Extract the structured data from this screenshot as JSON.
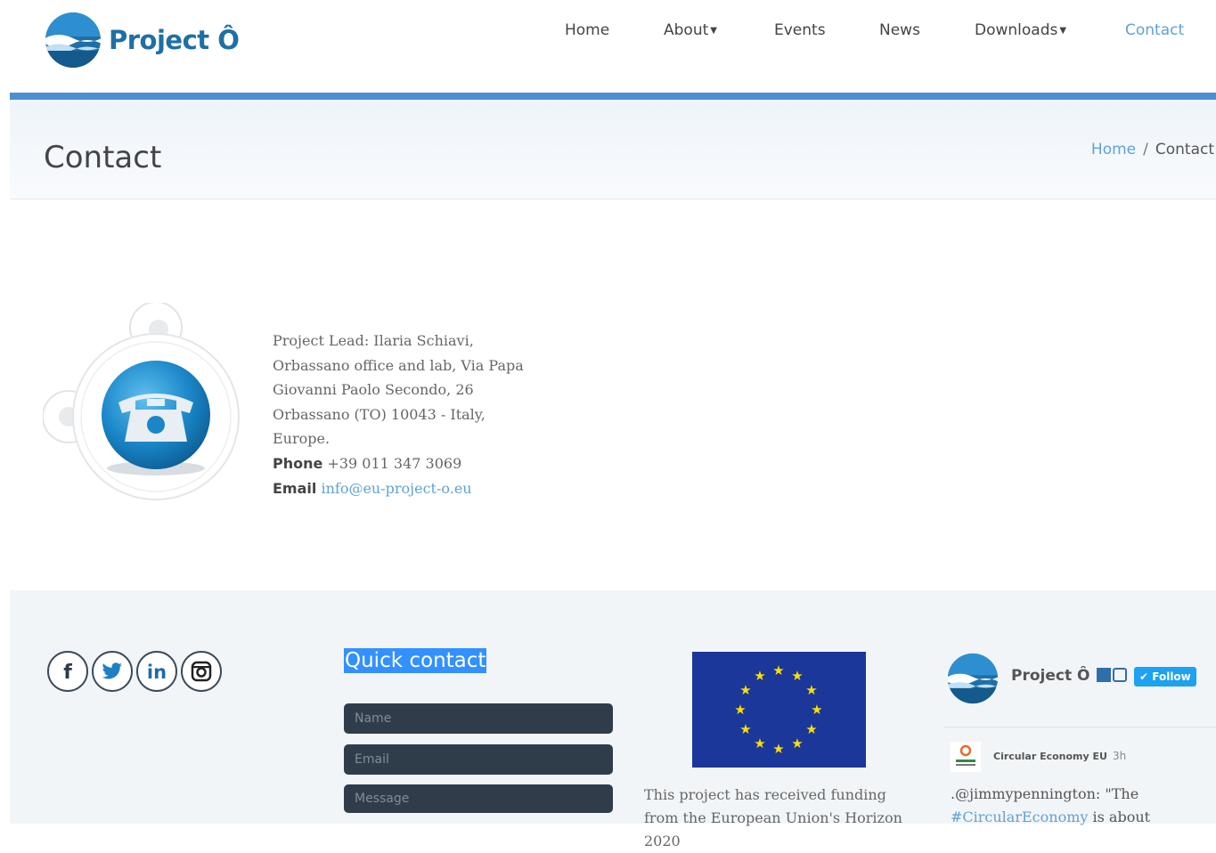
{
  "header": {
    "logo_text": "Project Ô",
    "nav": [
      {
        "label": "Home",
        "dropdown": false,
        "active": false
      },
      {
        "label": "About",
        "dropdown": true,
        "active": false
      },
      {
        "label": "Events",
        "dropdown": false,
        "active": false
      },
      {
        "label": "News",
        "dropdown": false,
        "active": false
      },
      {
        "label": "Downloads",
        "dropdown": true,
        "active": false
      },
      {
        "label": "Contact",
        "dropdown": false,
        "active": true
      }
    ]
  },
  "page": {
    "title": "Contact",
    "breadcrumb": {
      "home": "Home",
      "separator": "/",
      "current": "Contact"
    }
  },
  "contact": {
    "lines": [
      "Project Lead: Ilaria Schiavi,",
      "Orbassano office and lab, Via Papa",
      "Giovanni Paolo Secondo, 26",
      "Orbassano (TO) 10043 - Italy,",
      "Europe."
    ],
    "phone_label": "Phone",
    "phone": "+39 011 347 3069",
    "email_label": "Email",
    "email": "info@eu-project-o.eu"
  },
  "footer": {
    "social_icons": [
      "facebook-icon",
      "twitter-icon",
      "linkedin-icon",
      "instagram-icon"
    ],
    "quick_contact": {
      "title": "Quick contact",
      "name_placeholder": "Name",
      "email_placeholder": "Email",
      "message_placeholder": "Message"
    },
    "funding_text": "This project has received funding from the European Union's Horizon 2020",
    "twitter": {
      "account_name": "Project Ô",
      "follow_label": "Follow",
      "tweet_author": "Circular Economy EU",
      "tweet_time": "3h",
      "tweet_text_start": ".@jimmypennington: \"The",
      "tweet_hashtag": "#CircularEconomy",
      "tweet_text_end": " is about"
    }
  },
  "colors": {
    "accent": "#4a8fd1",
    "link": "#5fa2d4",
    "footer_field": "#2f3d4b",
    "eu_blue": "#1a3799",
    "eu_star": "#ffdd00"
  }
}
